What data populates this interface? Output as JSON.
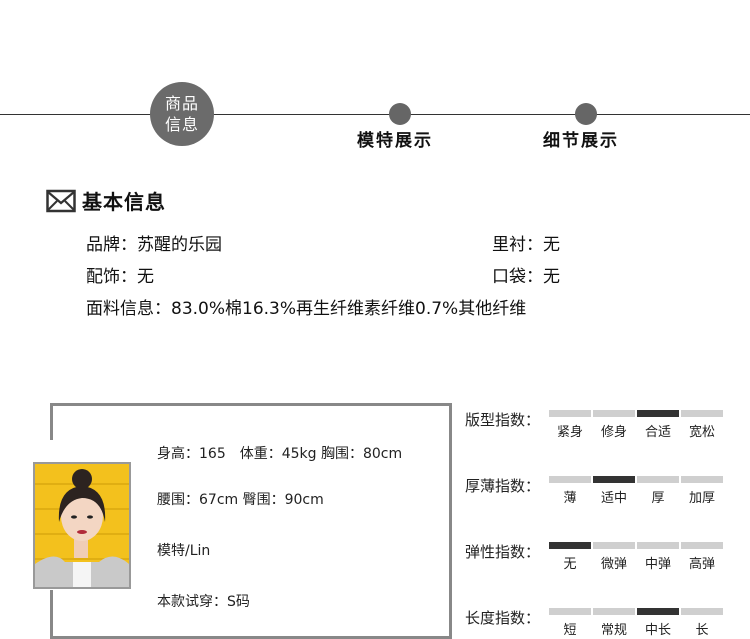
{
  "timeline": {
    "active_line1": "商品",
    "active_line2": "信息",
    "steps": [
      "模特展示",
      "细节展示"
    ]
  },
  "basic": {
    "title": "基本信息",
    "brand": "品牌：苏醒的乐园",
    "lining": "里衬：无",
    "accessory": "配饰：无",
    "pocket": "口袋：无",
    "fabric": "面料信息：83.0%棉16.3%再生纤维素纤维0.7%其他纤维"
  },
  "model": {
    "measure1": "身高：165　体重：45kg  胸围：80cm",
    "measure2": "腰围：67cm  臀围：90cm",
    "name": "模特/Lin",
    "size": "本款试穿：S码"
  },
  "indices": [
    {
      "label": "版型指数：",
      "options": [
        "紧身",
        "修身",
        "合适",
        "宽松"
      ],
      "selected": 2
    },
    {
      "label": "厚薄指数：",
      "options": [
        "薄",
        "适中",
        "厚",
        "加厚"
      ],
      "selected": 1
    },
    {
      "label": "弹性指数：",
      "options": [
        "无",
        "微弹",
        "中弹",
        "高弹"
      ],
      "selected": 0
    },
    {
      "label": "长度指数：",
      "options": [
        "短",
        "常规",
        "中长",
        "长"
      ],
      "selected": 2
    }
  ],
  "colors": {
    "accent_circle": "#6b6b6b",
    "bar_on": "#333333",
    "bar_off": "#cfcfcf"
  },
  "icons": {
    "section": "envelope-icon"
  }
}
